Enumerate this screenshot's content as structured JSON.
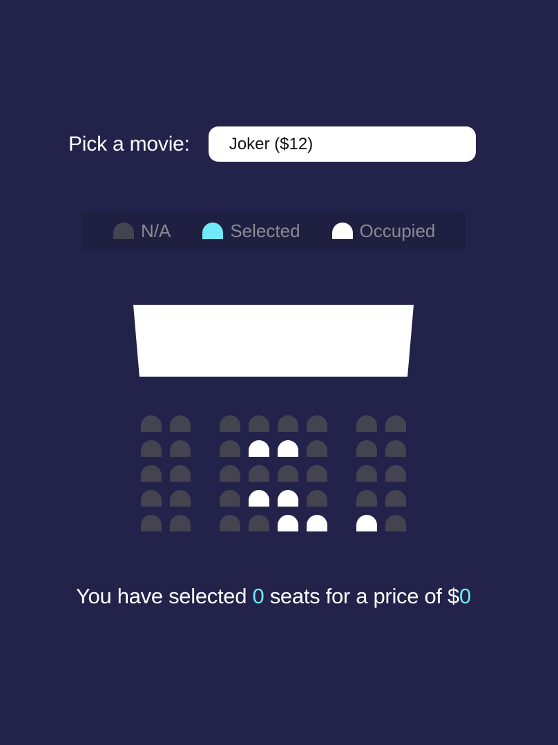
{
  "picker": {
    "label": "Pick a movie:",
    "selected_movie": "Joker ($12)"
  },
  "legend": {
    "items": [
      {
        "label": "N/A",
        "color": "#444451"
      },
      {
        "label": "Selected",
        "color": "#6feaf6"
      },
      {
        "label": "Occupied",
        "color": "#ffffff"
      }
    ]
  },
  "seating": {
    "rows": [
      [
        "na",
        "na",
        "na",
        "na",
        "na",
        "na",
        "na",
        "na"
      ],
      [
        "na",
        "na",
        "na",
        "occupied",
        "occupied",
        "na",
        "na",
        "na"
      ],
      [
        "na",
        "na",
        "na",
        "na",
        "na",
        "na",
        "na",
        "na"
      ],
      [
        "na",
        "na",
        "na",
        "occupied",
        "occupied",
        "na",
        "na",
        "na"
      ],
      [
        "na",
        "na",
        "na",
        "na",
        "occupied",
        "occupied",
        "occupied",
        "na"
      ]
    ]
  },
  "summary": {
    "prefix": "You have selected ",
    "count": "0",
    "middle": " seats for a price of $",
    "price": "0"
  },
  "colors": {
    "background": "#23224a",
    "seat_na": "#444451",
    "seat_selected": "#6feaf6",
    "seat_occupied": "#ffffff"
  }
}
